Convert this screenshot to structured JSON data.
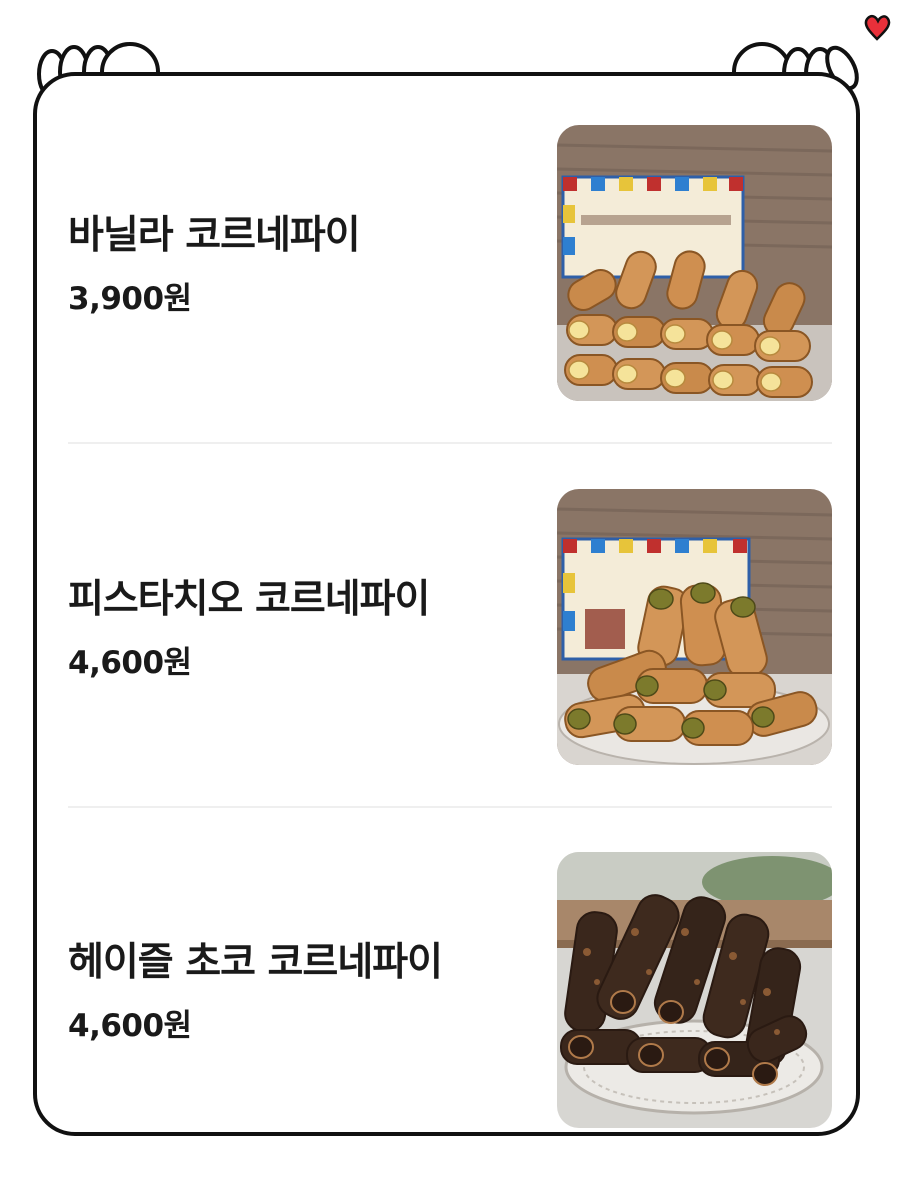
{
  "menu": {
    "items": [
      {
        "name": "바닐라 코르네파이",
        "price": "3,900원",
        "photo_icon": "vanilla-cornet-pie-photo"
      },
      {
        "name": "피스타치오 코르네파이",
        "price": "4,600원",
        "photo_icon": "pistachio-cornet-pie-photo"
      },
      {
        "name": "헤이즐 초코 코르네파이",
        "price": "4,600원",
        "photo_icon": "hazel-choco-cornet-pie-photo"
      }
    ]
  },
  "decor": {
    "heart_color": "#e8303a",
    "frame_color": "#111111",
    "divider_color": "#efefef"
  }
}
